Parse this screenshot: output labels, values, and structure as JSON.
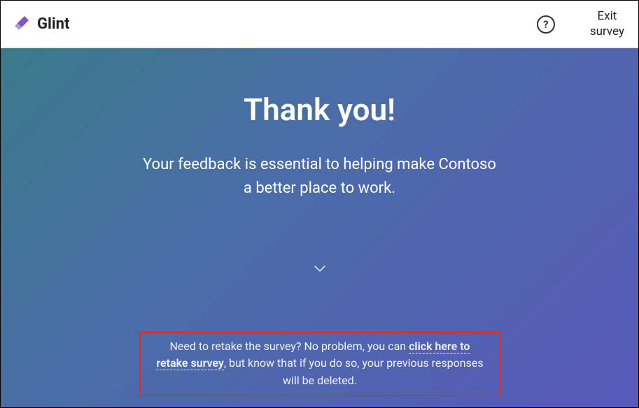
{
  "header": {
    "brand": "Glint",
    "exit_label": "Exit\nsurvey"
  },
  "main": {
    "title": "Thank you!",
    "subtitle_line1": "Your feedback is essential to helping make Contoso",
    "subtitle_line2": "a better place to work."
  },
  "retake": {
    "text_before": "Need to retake the survey? No problem, you can ",
    "link_text": "click here to retake survey",
    "text_after": ", but know that if you do so, your previous responses will be deleted."
  }
}
